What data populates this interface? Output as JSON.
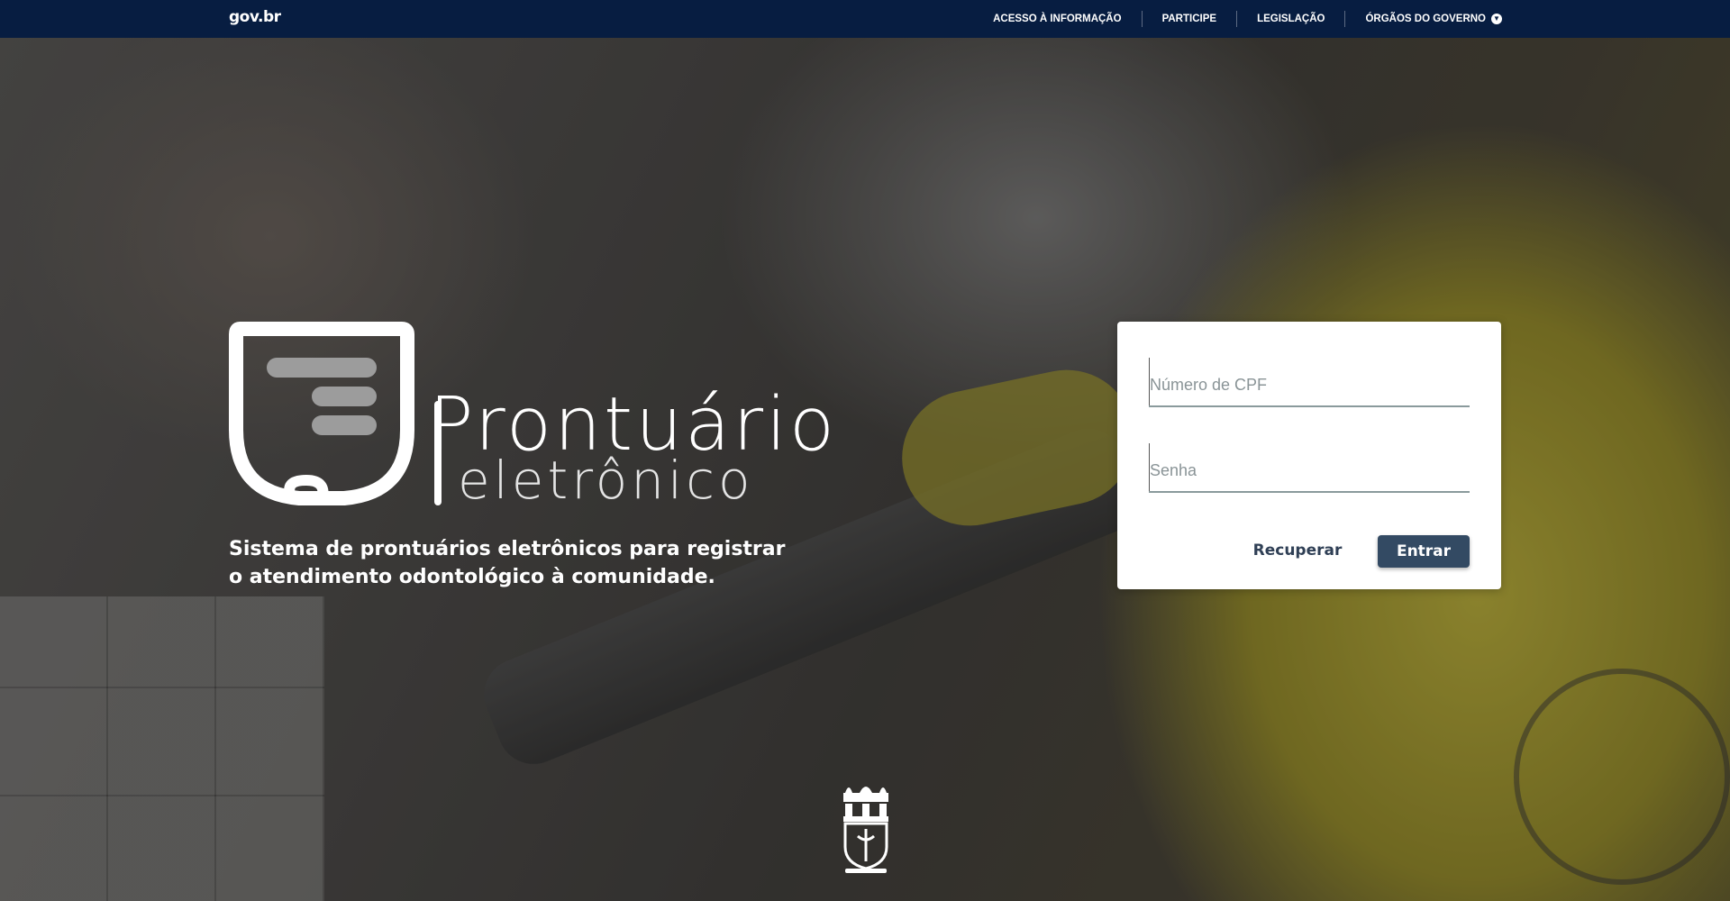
{
  "gov_bar": {
    "logo": "gov.br",
    "nav": [
      {
        "label": "ACESSO À INFORMAÇÃO"
      },
      {
        "label": "PARTICIPE"
      },
      {
        "label": "LEGISLAÇÃO"
      },
      {
        "label": "ÓRGÃOS DO GOVERNO"
      }
    ],
    "dropdown_icon": "chevron-down-icon",
    "background": "#071d41"
  },
  "brand": {
    "title": "Prontuário",
    "subtitle": "eletrônico",
    "icon": "shield-icon",
    "tagline": "Sistema de prontuários eletrônicos para registrar o atendimento odontológico à comunidade."
  },
  "login": {
    "cpf_placeholder": "Número de CPF",
    "cpf_value": "",
    "password_placeholder": "Senha",
    "password_value": "",
    "recover_label": "Recuperar",
    "submit_label": "Entrar",
    "accent": "#334a63"
  },
  "footer": {
    "emblem": "university-emblem-icon"
  }
}
